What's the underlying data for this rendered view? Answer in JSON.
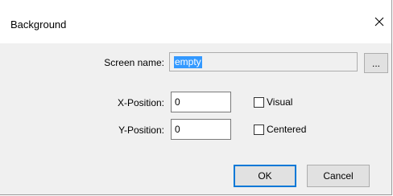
{
  "dialog": {
    "title": "Background",
    "close_glyph": "✕"
  },
  "form": {
    "screen_name_label": "Screen name:",
    "screen_name_value": "empty",
    "browse_label": "...",
    "x_label": "X-Position:",
    "x_value": "0",
    "y_label": "Y-Position:",
    "y_value": "0",
    "visual_label": "Visual",
    "visual_checked": false,
    "centered_label": "Centered",
    "centered_checked": false
  },
  "buttons": {
    "ok_label": "OK",
    "cancel_label": "Cancel"
  },
  "colors": {
    "accent": "#0078d7",
    "selection": "#3399ff",
    "dialog_bg": "#f0f0f0"
  }
}
